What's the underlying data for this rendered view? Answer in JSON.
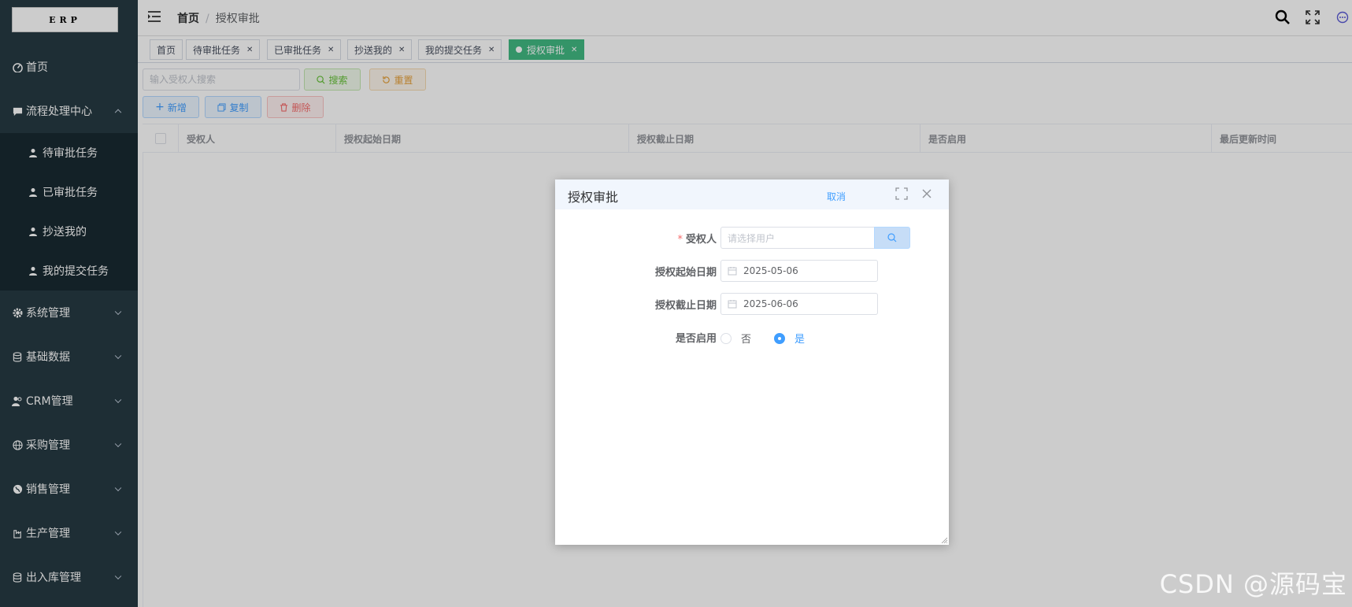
{
  "logo": {
    "text": "ERP"
  },
  "sidebar": {
    "items": [
      {
        "label": "首页",
        "icon": "dashboard-icon"
      },
      {
        "label": "流程处理中心",
        "icon": "chat-icon",
        "expanded": true,
        "children": [
          {
            "label": "待审批任务",
            "icon": "user-icon"
          },
          {
            "label": "已审批任务",
            "icon": "user-icon"
          },
          {
            "label": "抄送我的",
            "icon": "user-icon"
          },
          {
            "label": "我的提交任务",
            "icon": "user-icon"
          }
        ]
      },
      {
        "label": "系统管理",
        "icon": "gear-icon"
      },
      {
        "label": "基础数据",
        "icon": "database-icon"
      },
      {
        "label": "CRM管理",
        "icon": "users-icon"
      },
      {
        "label": "采购管理",
        "icon": "globe-icon"
      },
      {
        "label": "销售管理",
        "icon": "globe-filled-icon"
      },
      {
        "label": "生产管理",
        "icon": "factory-icon"
      },
      {
        "label": "出入库管理",
        "icon": "database-icon"
      }
    ]
  },
  "header": {
    "breadcrumb": [
      "首页",
      "授权审批"
    ],
    "breadcrumb_sep": "/",
    "icons": [
      "search-icon",
      "fullscreen-icon",
      "message-icon"
    ]
  },
  "tags": [
    {
      "label": "首页",
      "closable": false
    },
    {
      "label": "待审批任务",
      "closable": true
    },
    {
      "label": "已审批任务",
      "closable": true
    },
    {
      "label": "抄送我的",
      "closable": true
    },
    {
      "label": "我的提交任务",
      "closable": true
    },
    {
      "label": "授权审批",
      "closable": true,
      "active": true
    }
  ],
  "toolbar": {
    "search_placeholder": "输入受权人搜索",
    "search_label": "搜索",
    "reset_label": "重置",
    "add_label": "新增",
    "copy_label": "复制",
    "delete_label": "删除"
  },
  "table": {
    "columns": [
      "受权人",
      "授权起始日期",
      "授权截止日期",
      "是否启用",
      "最后更新时间"
    ]
  },
  "dialog": {
    "title": "授权审批",
    "cancel_label": "取消",
    "fields": {
      "grantee": {
        "label": "受权人",
        "required": true,
        "placeholder": "请选择用户",
        "value": ""
      },
      "start_date": {
        "label": "授权起始日期",
        "value": "2025-05-06"
      },
      "end_date": {
        "label": "授权截止日期",
        "value": "2025-06-06"
      },
      "enabled": {
        "label": "是否启用",
        "options": [
          "否",
          "是"
        ],
        "selected": "是"
      }
    }
  },
  "watermark": "CSDN @源码宝",
  "colors": {
    "accent": "#409eff",
    "active_tag": "#42b983",
    "sidebar_bg": "#263a43",
    "danger": "#f56c6c",
    "success": "#67c23a",
    "warning": "#e6a23c"
  }
}
